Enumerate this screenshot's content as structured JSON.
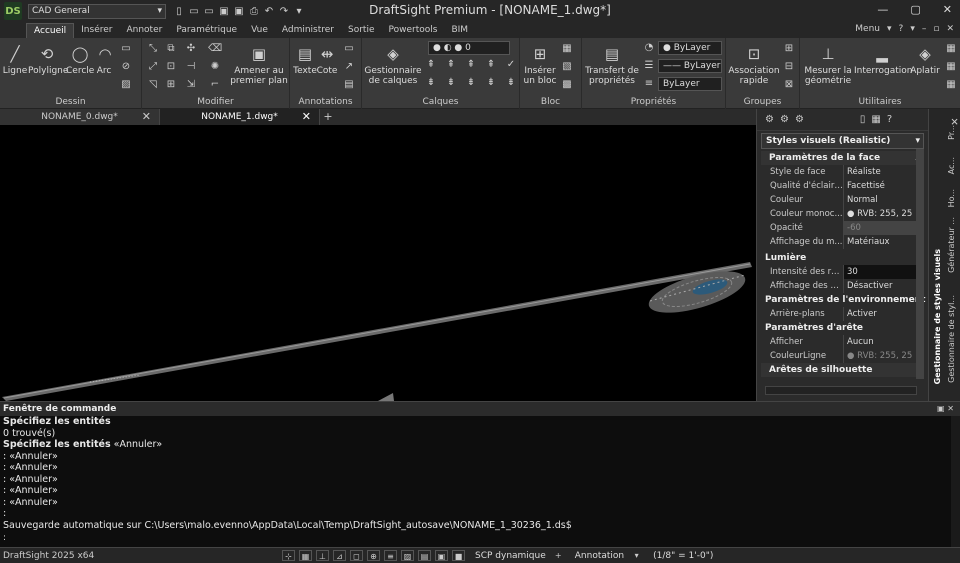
{
  "app": {
    "title": "DraftSight Premium - [NONAME_1.dwg*]",
    "logo_text": "DS",
    "workspace": "CAD General",
    "menu_label": "Menu"
  },
  "menu_tabs": [
    "Accueil",
    "Insérer",
    "Annoter",
    "Paramétrique",
    "Vue",
    "Administrer",
    "Sortie",
    "Powertools",
    "BIM"
  ],
  "ribbon": {
    "panels": {
      "dessin": "Dessin",
      "modifier": "Modifier",
      "annotations": "Annotations",
      "calques": "Calques",
      "bloc": "Bloc",
      "proprietes": "Propriétés",
      "groupes": "Groupes",
      "utilitaires": "Utilitaires"
    },
    "buttons": {
      "ligne": "Ligne",
      "polyligne": "Polyligne",
      "cercle": "Cercle",
      "arc": "Arc",
      "amener_line1": "Amener au",
      "amener_line2": "premier plan",
      "texte": "Texte",
      "cote": "Cote",
      "gestion_line1": "Gestionnaire",
      "gestion_line2": "de calques",
      "inserer_line1": "Insérer",
      "inserer_line2": "un bloc",
      "transfert_line1": "Transfert de",
      "transfert_line2": "propriétés",
      "assoc_line1": "Association",
      "assoc_line2": "rapide",
      "mesurer_line1": "Mesurer la",
      "mesurer_line2": "géométrie",
      "interrogation": "Interrogation",
      "aplatir": "Aplatir"
    },
    "layer_value": "0",
    "bylayer1": "ByLayer",
    "bylayer2": "ByLayer",
    "bylayer3": "ByLayer"
  },
  "doc_tabs": [
    {
      "label": "NONAME_0.dwg*"
    },
    {
      "label": "NONAME_1.dwg*"
    }
  ],
  "properties": {
    "header": "Styles visuels (Realistic)",
    "sections": {
      "face": "Paramètres de la face",
      "lumiere": "Lumière",
      "env": "Paramètres de l'environnement",
      "arete": "Paramètres d'arête",
      "silhouette": "Arêtes de silhouette"
    },
    "rows": {
      "style_face_k": "Style de face",
      "style_face_v": "Réaliste",
      "qualite_k": "Qualité d'éclaira...",
      "qualite_v": "Facettisé",
      "couleur_k": "Couleur",
      "couleur_v": "Normal",
      "couleur_mono_k": "Couleur monoc...",
      "couleur_mono_v": "RVB: 255, 25",
      "opacite_k": "Opacité",
      "opacite_v": "-60",
      "affichage_m_k": "Affichage du m...",
      "affichage_m_v": "Matériaux",
      "intensite_k": "Intensité des re...",
      "intensite_v": "30",
      "affichage_o_k": "Affichage des o...",
      "affichage_o_v": "Désactiver",
      "arriere_k": "Arrière-plans",
      "arriere_v": "Activer",
      "afficher_k": "Afficher",
      "afficher_v": "Aucun",
      "couleurligne_k": "CouleurLigne",
      "couleurligne_v": "RVB: 255, 25"
    }
  },
  "side_tabs": {
    "pr": "Pr...",
    "ac": "Ac...",
    "ho": "Ho...",
    "gen": "Générateur ...",
    "gest_styl": "Gestionnaire de styl...",
    "gest_full": "Gestionnaire de styles visuels"
  },
  "command": {
    "title": "Fenêtre de commande",
    "lines": [
      {
        "bold": "Spécifiez les entités",
        "rest": ""
      },
      {
        "bold": "",
        "rest": "0 trouvé(s)"
      },
      {
        "bold": "Spécifiez les entités",
        "rest": " «Annuler»"
      },
      {
        "bold": "",
        "rest": ": «Annuler»"
      },
      {
        "bold": "",
        "rest": ": «Annuler»"
      },
      {
        "bold": "",
        "rest": ": «Annuler»"
      },
      {
        "bold": "",
        "rest": ": «Annuler»"
      },
      {
        "bold": "",
        "rest": ": «Annuler»"
      },
      {
        "bold": "",
        "rest": ":"
      },
      {
        "bold": "",
        "rest": "Sauvegarde automatique sur C:\\Users\\malo.evenno\\AppData\\Local\\Temp\\DraftSight_autosave\\NONAME_1_30236_1.ds$"
      }
    ],
    "prompt": ":"
  },
  "status": {
    "version": "DraftSight 2025 x64",
    "scp": "SCP dynamique",
    "annotation": "Annotation",
    "scale": "(1/8\" = 1'-0\")"
  },
  "colors": {
    "accent": "#4caf50",
    "bg": "#000000",
    "panel": "#3a3a3a"
  }
}
